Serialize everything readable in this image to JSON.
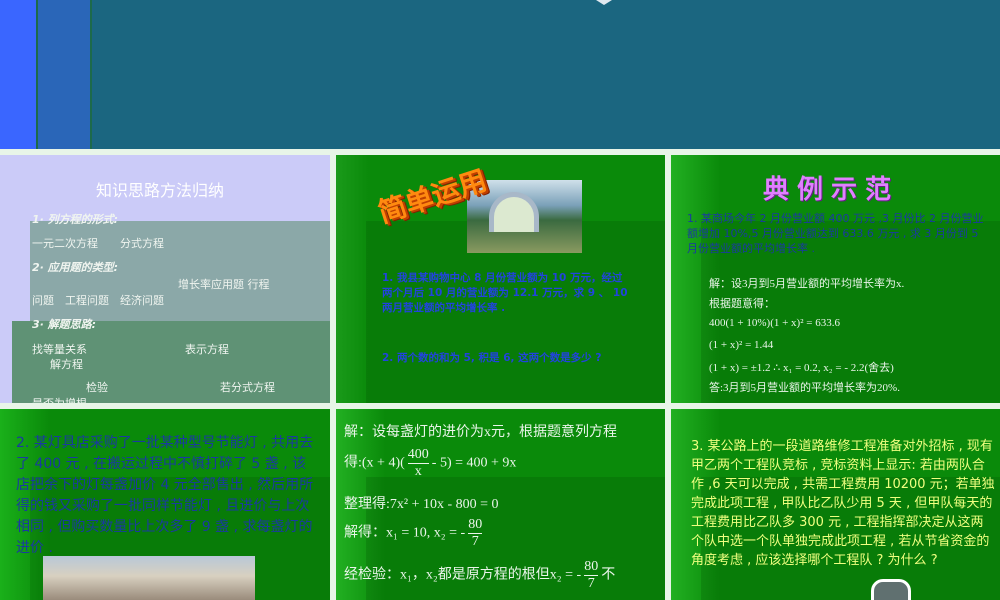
{
  "slide1": {
    "title": "知识思路方法归纳",
    "h1": "1· 列方程的形式:",
    "l1": "一元二次方程　　分式方程",
    "h2": "2· 应用题的类型:",
    "l2a": "增长率应用题  行程",
    "l2b": "问题　工程问题　经济问题",
    "h3": "3· 解题思路:",
    "l3a": "找等量关系",
    "l3b": "表示方程",
    "l3c": "解方程",
    "l3d": "检验",
    "l3e": "若分式方程",
    "l3f": "是否为增根"
  },
  "slide2": {
    "wordart": "简单运用",
    "p1": "1. 我县某购物中心 8 月份营业额为 10 万元，经过两个月后 10 月的营业额为 12.1 万元，求 9 、 10 两月营业额的平均增长率 .",
    "p2": "2. 两个数的和为 5, 积是 6, 这两个数是多少 ?"
  },
  "slide3": {
    "wordart": "典例示范",
    "question": "1. 某商场今年 2 月份营业额 400 万元 ,3 月份比 2 月份营业额增加 10%,5 月份营业额达到 633.6 万元 , 求 3 月份到 5 月份营业额的平均增长率 .",
    "lines": [
      "解：设3月到5月营业额的平均增长率为x.",
      "根据题意得：",
      "400(1 + 10%)(1 + x)² = 633.6",
      "(1 + x)² = 1.44",
      "(1 + x) = ±1.2 ∴ x₁ = 0.2, x₂ = - 2.2(舍去)",
      "答:3月到5月营业额的平均增长率为20%."
    ]
  },
  "slide4": {
    "question": "2. 某灯具店采购了一批某种型号节能灯 , 共用去了 400 元 , 在搬运过程中不慎打碎了 5 盏 , 该店把余下的灯每盏加价 4 元全部售出 , 然后用所得的钱又采购了一批同样节能灯 , 且进价与上次相同 , 但购买数量比上次多了 9 盏 , 求每盏灯的进价 ."
  },
  "slide5": {
    "l1": "解：设每盏灯的进价为x元，根据题意列方程",
    "l2a": "得:(x + 4)(",
    "l2n": "400",
    "l2d": "x",
    "l2b": "- 5) = 400 + 9x",
    "l3": "整理得:7x² + 10x - 800 = 0",
    "l4a": "解得：x₁ = 10, x₂ = -",
    "l4n": "80",
    "l4d": "7",
    "l5a": "经检验：x₁，x₂都是原方程的根但x₂ = -",
    "l5n": "80",
    "l5d": "7",
    "l5b": "不"
  },
  "slide6": {
    "question": "3. 某公路上的一段道路维修工程准备对外招标 , 现有甲乙两个工程队竞标 , 竞标资料上显示: 若由两队合作 ,6 天可以完成 , 共需工程费用 10200 元；若单独完成此项工程 , 甲队比乙队少用 5 天 , 但甲队每天的工程费用比乙队多 300 元 , 工程指挥部决定从这两个队中选一个队单独完成此项工程 , 若从节省资金的角度考虑 , 应该选择哪个工程队 ? 为什么 ?"
  }
}
